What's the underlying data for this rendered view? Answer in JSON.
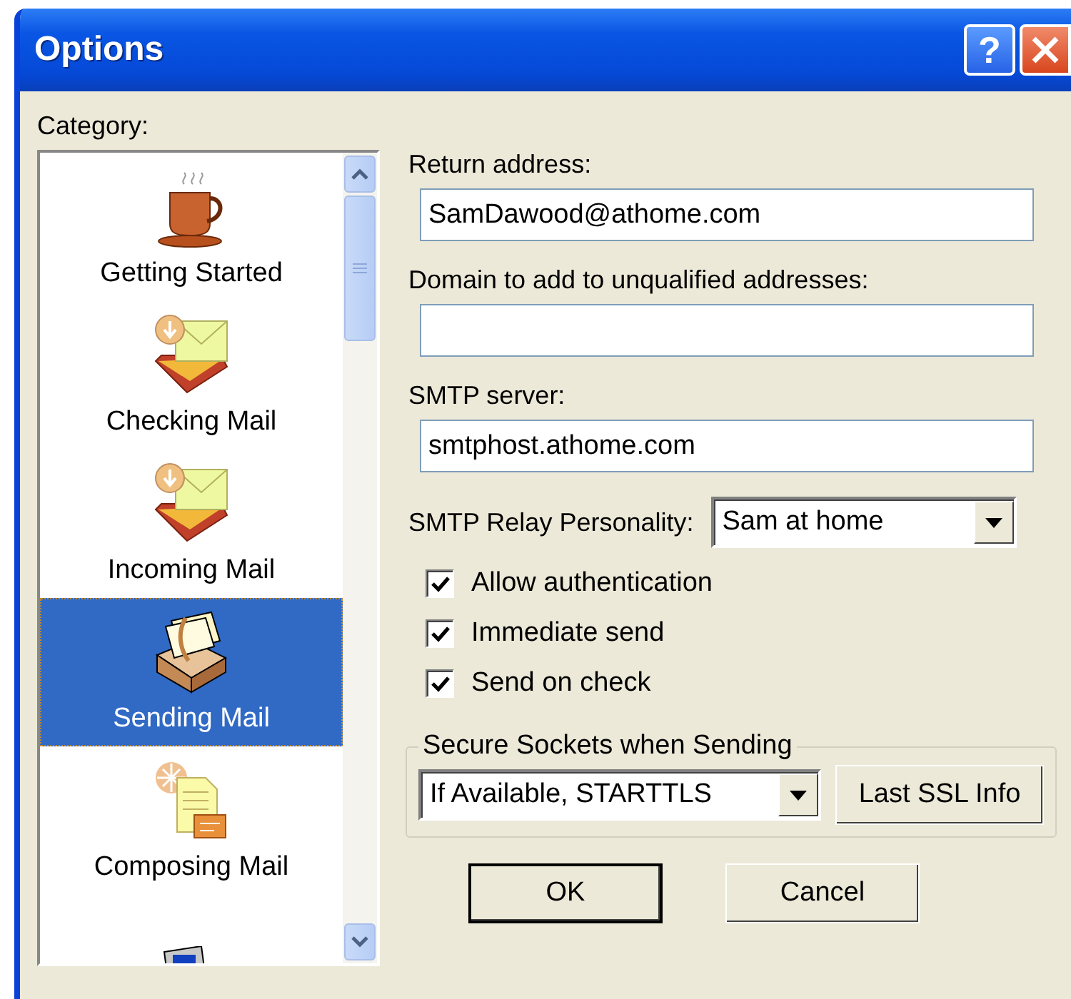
{
  "window": {
    "title": "Options",
    "help_button": "?"
  },
  "category": {
    "label": "Category:",
    "items": [
      {
        "kind": "cup",
        "label": "Getting Started",
        "selected": false
      },
      {
        "kind": "inbox",
        "label": "Checking Mail",
        "selected": false
      },
      {
        "kind": "inbox",
        "label": "Incoming Mail",
        "selected": false
      },
      {
        "kind": "outbox",
        "label": "Sending Mail",
        "selected": true
      },
      {
        "kind": "compose",
        "label": "Composing Mail",
        "selected": false
      },
      {
        "kind": "computer",
        "selected": false
      }
    ]
  },
  "fields": [
    {
      "label": "Return address:",
      "value": "SamDawood@athome.com"
    },
    {
      "label": "Domain to add to unqualified addresses:"
    },
    {
      "label": "SMTP server:",
      "value": "smtphost.athome.com"
    }
  ],
  "relay_personality": {
    "label": "SMTP Relay Personality:",
    "value": "Sam at home"
  },
  "checkboxes": [
    {
      "label": "Allow authentication",
      "checked": true
    },
    {
      "label": "Immediate send",
      "checked": true
    },
    {
      "label": "Send on check",
      "checked": true
    }
  ],
  "secure_sockets": {
    "legend": "Secure Sockets when Sending",
    "value": "If Available, STARTTLS",
    "button": "Last SSL Info"
  },
  "buttons": [
    {
      "label": "OK",
      "default": true
    },
    {
      "label": "Cancel",
      "default": false
    }
  ]
}
